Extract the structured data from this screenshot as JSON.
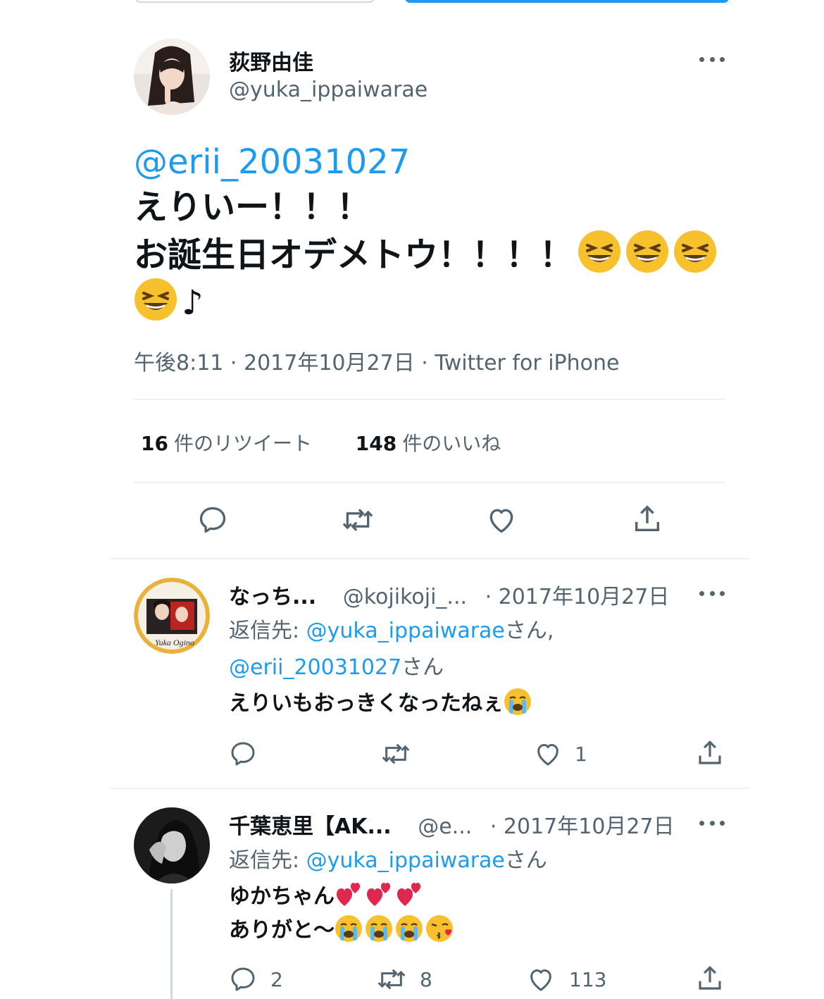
{
  "colors": {
    "accent": "#1d9bf0",
    "muted": "#536471",
    "text": "#0f1419",
    "divider": "#eff3f4"
  },
  "main_tweet": {
    "name": "荻野由佳",
    "handle": "@yuka_ippaiwarae",
    "mention": "@erii_20031027",
    "line1": "えりいー！！！",
    "line2": "お誕生日オデメトウ！！！！",
    "line3_tail": "♪",
    "emoji": "grinning-squinting-face",
    "time": "午後8:11",
    "date": "2017年10月27日",
    "client": "Twitter for iPhone",
    "retweets_count": "16",
    "retweets_label": "件のリツイート",
    "likes_count": "148",
    "likes_label": "件のいいね"
  },
  "replies": [
    {
      "name": "なっち...",
      "handle": "@kojikoji_...",
      "date": "· 2017年10月27日",
      "reply_label": "返信先:",
      "reply_mention1": "@yuka_ippaiwarae",
      "reply_suffix1": "さん,",
      "reply_mention2": "@erii_20031027",
      "reply_suffix2": "さん",
      "text": "えりいもおっきくなったねぇ",
      "emoji": "loudly-crying-face",
      "likes": "1"
    },
    {
      "name": "千葉恵里【AK...",
      "handle": "@e...",
      "date": "· 2017年10月27日",
      "reply_label": "返信先:",
      "reply_mention1": "@yuka_ippaiwarae",
      "reply_suffix1": "さん",
      "text_line1": "ゆかちゃん",
      "text_line2": "ありがと〜",
      "emoji_line1": "two-hearts",
      "emoji_line2": [
        "loudly-crying-face",
        "loudly-crying-face",
        "loudly-crying-face",
        "face-blowing-a-kiss"
      ],
      "replies": "2",
      "retweets": "8",
      "likes": "113"
    }
  ]
}
